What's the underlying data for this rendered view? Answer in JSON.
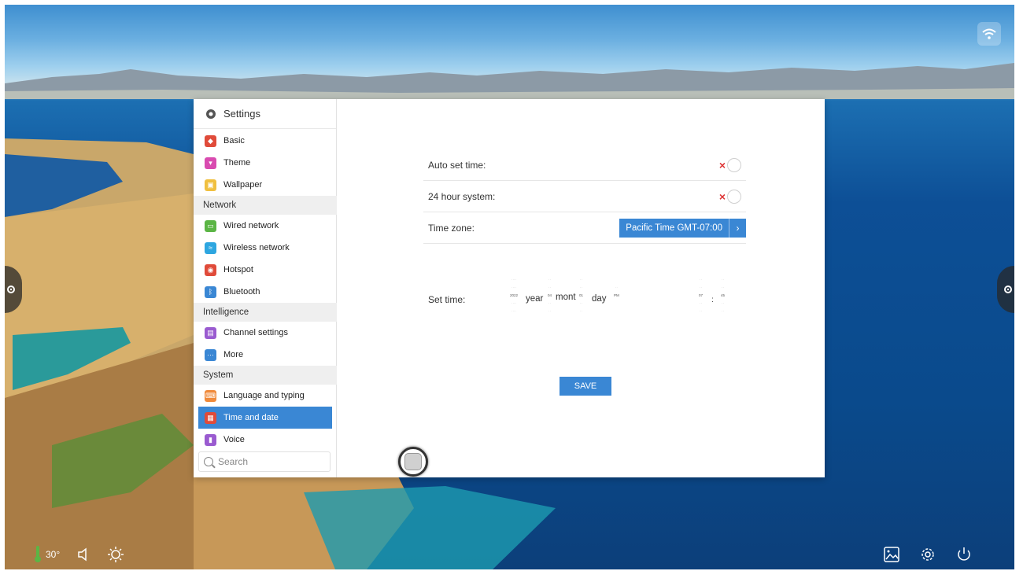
{
  "status_bar": {
    "temperature": "30°"
  },
  "settings": {
    "title": "Settings",
    "sidebar": {
      "items": [
        {
          "label": "Basic",
          "color": "#e04b3a"
        },
        {
          "label": "Theme",
          "color": "#d94bb0"
        },
        {
          "label": "Wallpaper",
          "color": "#f0c040"
        }
      ],
      "network_section": "Network",
      "network_items": [
        {
          "label": "Wired network",
          "color": "#5bb545"
        },
        {
          "label": "Wireless network",
          "color": "#2ea6e0"
        },
        {
          "label": "Hotspot",
          "color": "#e04b3a"
        },
        {
          "label": "Bluetooth",
          "color": "#3a87d4"
        }
      ],
      "intelligence_section": "Intelligence",
      "intelligence_items": [
        {
          "label": "Channel settings",
          "color": "#9a5bd0"
        },
        {
          "label": "More",
          "color": "#3a87d4"
        }
      ],
      "system_section": "System",
      "system_items": [
        {
          "label": "Language and typing",
          "color": "#f08a3a"
        },
        {
          "label": "Time and date",
          "color": "#e04b3a"
        },
        {
          "label": "Voice",
          "color": "#9a5bd0"
        }
      ],
      "search_placeholder": "Search"
    },
    "time_and_date": {
      "auto_set_time_label": "Auto set time:",
      "auto_set_time_enabled": false,
      "hour24_label": "24 hour system:",
      "hour24_enabled": false,
      "time_zone_label": "Time zone:",
      "time_zone_value": "Pacific Time GMT-07:00",
      "set_time_label": "Set time:",
      "year_unit": "year",
      "month_unit": "mont",
      "day_unit": "day",
      "year_value": "2022",
      "month_value": "04",
      "day_value": "01",
      "ampm_value": "PM",
      "hour_value": "07",
      "minute_value": "45",
      "save_label": "SAVE"
    }
  },
  "accent_color": "#3a87d4"
}
